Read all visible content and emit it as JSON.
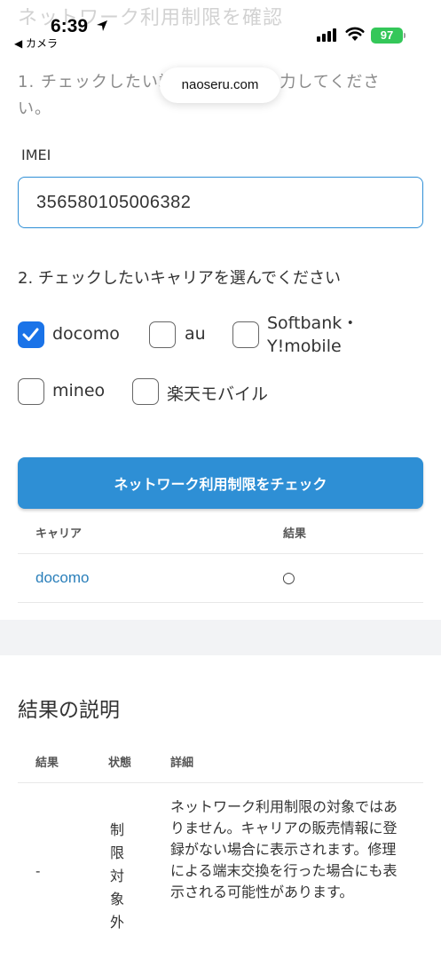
{
  "page": {
    "faded_title": "ネットワーク利用制限を確認"
  },
  "status_bar": {
    "time": "6:39",
    "back_app": "◀ カメラ",
    "battery": "97"
  },
  "browser": {
    "url": "naoseru.com"
  },
  "form": {
    "step1": "1. チェックしたい端末のIMEIを入力してください。",
    "imei_label": "IMEI",
    "imei_value": "356580105006382",
    "step2": "2. チェックしたいキャリアを選んでください",
    "carriers": [
      {
        "label": "docomo",
        "checked": true
      },
      {
        "label": "au",
        "checked": false
      },
      {
        "label": "Softbank・",
        "label2": "Y!mobile",
        "checked": false
      },
      {
        "label": "mineo",
        "checked": false
      },
      {
        "label": "楽天モバイル",
        "checked": false
      }
    ],
    "check_button": "ネットワーク利用制限をチェック"
  },
  "results": {
    "col_carrier": "キャリア",
    "col_result": "結果",
    "rows": [
      {
        "carrier": "docomo",
        "result": "○"
      }
    ]
  },
  "explanation": {
    "title": "結果の説明",
    "col_result": "結果",
    "col_status": "状態",
    "col_detail": "詳細",
    "row": {
      "result": "-",
      "status_chars": [
        "制",
        "限",
        "対",
        "象",
        "外"
      ],
      "detail": "ネットワーク利用制限の対象ではありません。キャリアの販売情報に登録がない場合に表示されます。修理による端末交換を行った場合にも表示される可能性があります。"
    }
  },
  "colors": {
    "accent": "#2e8fd5",
    "checkbox_checked": "#1a73e8",
    "link": "#2a7fba",
    "battery": "#34c759"
  }
}
